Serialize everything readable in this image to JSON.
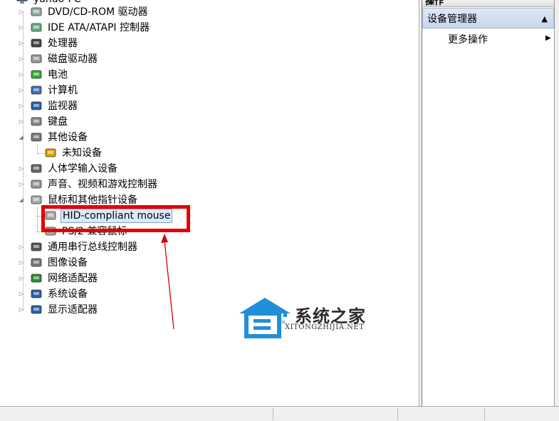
{
  "tree": {
    "top_label": "yanuo-PC",
    "items": [
      {
        "label": "DVD/CD-ROM 驱动器",
        "icon": "dvd-drive-icon",
        "expander": "collapsed"
      },
      {
        "label": "IDE ATA/ATAPI 控制器",
        "icon": "ide-controller-icon",
        "expander": "collapsed"
      },
      {
        "label": "处理器",
        "icon": "processor-icon",
        "expander": "collapsed"
      },
      {
        "label": "磁盘驱动器",
        "icon": "disk-drive-icon",
        "expander": "collapsed"
      },
      {
        "label": "电池",
        "icon": "battery-icon",
        "expander": "collapsed"
      },
      {
        "label": "计算机",
        "icon": "computer-icon",
        "expander": "collapsed"
      },
      {
        "label": "监视器",
        "icon": "monitor-icon",
        "expander": "collapsed"
      },
      {
        "label": "键盘",
        "icon": "keyboard-icon",
        "expander": "collapsed"
      },
      {
        "label": "其他设备",
        "icon": "other-devices-icon",
        "expander": "expanded"
      },
      {
        "label": "未知设备",
        "icon": "unknown-device-icon",
        "expander": "none",
        "child": true
      },
      {
        "label": "人体学输入设备",
        "icon": "hid-icon",
        "expander": "collapsed"
      },
      {
        "label": "声音、视频和游戏控制器",
        "icon": "sound-icon",
        "expander": "collapsed"
      },
      {
        "label": "鼠标和其他指针设备",
        "icon": "mouse-icon",
        "expander": "expanded"
      },
      {
        "label": "HID-compliant mouse",
        "icon": "mouse-icon",
        "expander": "none",
        "child": true,
        "selected": true
      },
      {
        "label": "PS/2 兼容鼠标",
        "icon": "mouse-icon",
        "expander": "none",
        "child": true
      },
      {
        "label": "通用串行总线控制器",
        "icon": "usb-icon",
        "expander": "collapsed"
      },
      {
        "label": "图像设备",
        "icon": "imaging-device-icon",
        "expander": "collapsed"
      },
      {
        "label": "网络适配器",
        "icon": "network-adapter-icon",
        "expander": "collapsed"
      },
      {
        "label": "系统设备",
        "icon": "system-devices-icon",
        "expander": "collapsed"
      },
      {
        "label": "显示适配器",
        "icon": "display-adapter-icon",
        "expander": "collapsed"
      }
    ]
  },
  "actions": {
    "header": "操作",
    "section": "设备管理器",
    "more": "更多操作"
  },
  "watermark": {
    "title": "系统之家",
    "subtitle": "XITONGZHIJIA.NET"
  },
  "colors": {
    "highlight": "#e30000",
    "selection": "#dbe9f9",
    "section_bg": "#c7d7ec"
  }
}
